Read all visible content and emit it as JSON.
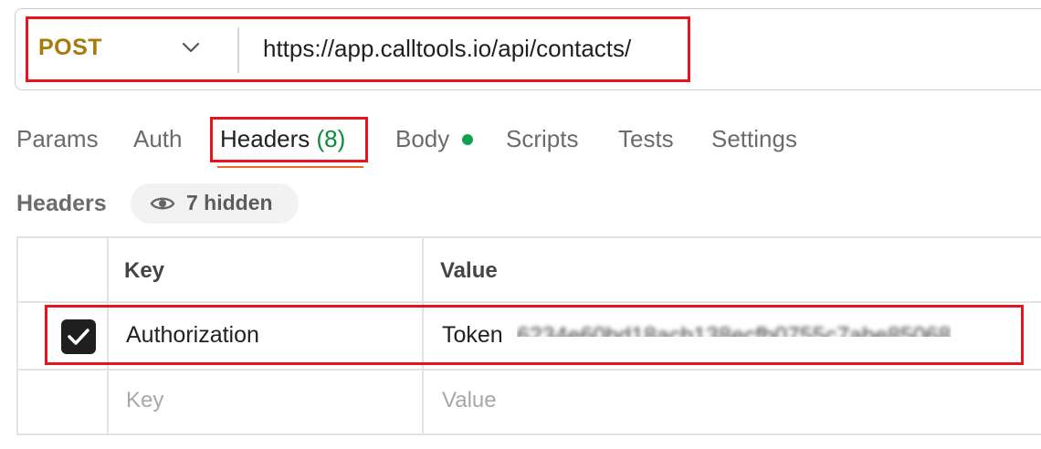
{
  "request": {
    "method": "POST",
    "url": "https://app.calltools.io/api/contacts/"
  },
  "tabs": [
    {
      "label": "Params"
    },
    {
      "label": "Auth"
    },
    {
      "label": "Headers",
      "count": "(8)"
    },
    {
      "label": "Body"
    },
    {
      "label": "Scripts"
    },
    {
      "label": "Tests"
    },
    {
      "label": "Settings"
    }
  ],
  "headers_section": {
    "title": "Headers",
    "hidden_label": "7 hidden"
  },
  "table": {
    "columns": [
      "Key",
      "Value"
    ],
    "rows": [
      {
        "checked": true,
        "key": "Authorization",
        "value": "Token",
        "value_obscured": "6234e60bd18acb138ecfb0755c7abe85068"
      }
    ],
    "placeholder": {
      "key": "Key",
      "value": "Value"
    }
  },
  "colors": {
    "method": "#a77b0a",
    "accent_underline": "#f06a24",
    "count": "#0b8a3c",
    "annotation": "#e4151c"
  }
}
